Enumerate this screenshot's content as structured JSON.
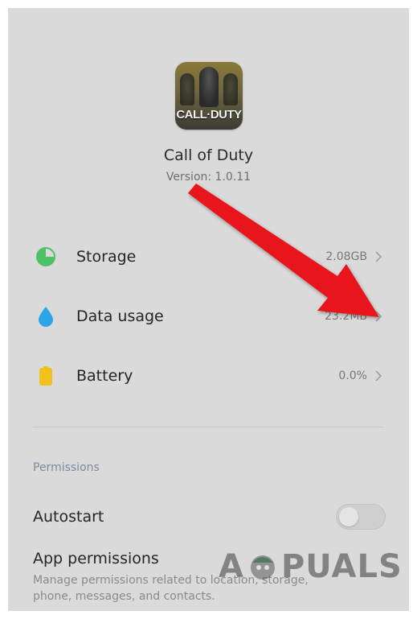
{
  "app": {
    "icon_text": "CALL·DUTY",
    "name": "Call of Duty",
    "version": "Version: 1.0.11"
  },
  "rows": [
    {
      "label": "Storage",
      "value": "2.08GB",
      "icon": "pie-chart-icon",
      "icon_color": "#4cc267"
    },
    {
      "label": "Data usage",
      "value": "23.2MB",
      "icon": "water-drop-icon",
      "icon_color": "#2aa6e6"
    },
    {
      "label": "Battery",
      "value": "0.0%",
      "icon": "battery-icon",
      "icon_color": "#f0c21b"
    }
  ],
  "permissions": {
    "section_title": "Permissions",
    "autostart_label": "Autostart",
    "autostart_on": false,
    "app_permissions_label": "App permissions",
    "app_permissions_desc": "Manage permissions related to location, storage, phone, messages, and contacts."
  },
  "watermark": {
    "left": "A",
    "right": "PUALS"
  },
  "colors": {
    "background": "#dadada",
    "annotation_arrow": "#e8161b",
    "section_title": "#7d8aa0"
  }
}
